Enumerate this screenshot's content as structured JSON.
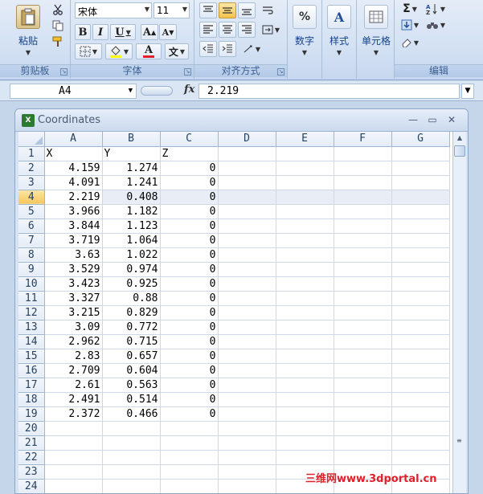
{
  "ribbon": {
    "clipboard": {
      "title": "剪贴板",
      "paste_label": "粘贴"
    },
    "font": {
      "title": "字体",
      "font_name": "宋体",
      "font_size": "11",
      "bold": "B",
      "italic": "I",
      "underline": "U",
      "grow": "A",
      "shrink": "A",
      "wen": "文"
    },
    "alignment": {
      "title": "对齐方式"
    },
    "number": {
      "label": "数字"
    },
    "styles": {
      "label": "样式"
    },
    "cells": {
      "label": "单元格"
    },
    "editing": {
      "title": "编辑",
      "sigma": "Σ"
    }
  },
  "formula_bar": {
    "name_box": "A4",
    "fx": "fx",
    "value": "2.219"
  },
  "workbook": {
    "title": "Coordinates",
    "columns": [
      "A",
      "B",
      "C",
      "D",
      "E",
      "F",
      "G"
    ],
    "selected_row": 4,
    "rows": [
      {
        "n": "1",
        "a": "X",
        "b": "Y",
        "c": "Z"
      },
      {
        "n": "2",
        "a": "4.159",
        "b": "1.274",
        "c": "0"
      },
      {
        "n": "3",
        "a": "4.091",
        "b": "1.241",
        "c": "0"
      },
      {
        "n": "4",
        "a": "2.219",
        "b": "0.408",
        "c": "0"
      },
      {
        "n": "5",
        "a": "3.966",
        "b": "1.182",
        "c": "0"
      },
      {
        "n": "6",
        "a": "3.844",
        "b": "1.123",
        "c": "0"
      },
      {
        "n": "7",
        "a": "3.719",
        "b": "1.064",
        "c": "0"
      },
      {
        "n": "8",
        "a": "3.63",
        "b": "1.022",
        "c": "0"
      },
      {
        "n": "9",
        "a": "3.529",
        "b": "0.974",
        "c": "0"
      },
      {
        "n": "10",
        "a": "3.423",
        "b": "0.925",
        "c": "0"
      },
      {
        "n": "11",
        "a": "3.327",
        "b": "0.88",
        "c": "0"
      },
      {
        "n": "12",
        "a": "3.215",
        "b": "0.829",
        "c": "0"
      },
      {
        "n": "13",
        "a": "3.09",
        "b": "0.772",
        "c": "0"
      },
      {
        "n": "14",
        "a": "2.962",
        "b": "0.715",
        "c": "0"
      },
      {
        "n": "15",
        "a": "2.83",
        "b": "0.657",
        "c": "0"
      },
      {
        "n": "16",
        "a": "2.709",
        "b": "0.604",
        "c": "0"
      },
      {
        "n": "17",
        "a": "2.61",
        "b": "0.563",
        "c": "0"
      },
      {
        "n": "18",
        "a": "2.491",
        "b": "0.514",
        "c": "0"
      },
      {
        "n": "19",
        "a": "2.372",
        "b": "0.466",
        "c": "0"
      },
      {
        "n": "20",
        "a": "",
        "b": "",
        "c": ""
      },
      {
        "n": "21",
        "a": "",
        "b": "",
        "c": ""
      },
      {
        "n": "22",
        "a": "",
        "b": "",
        "c": ""
      },
      {
        "n": "23",
        "a": "",
        "b": "",
        "c": ""
      },
      {
        "n": "24",
        "a": "",
        "b": "",
        "c": ""
      }
    ]
  },
  "watermark": "三维网www.3dportal.cn"
}
